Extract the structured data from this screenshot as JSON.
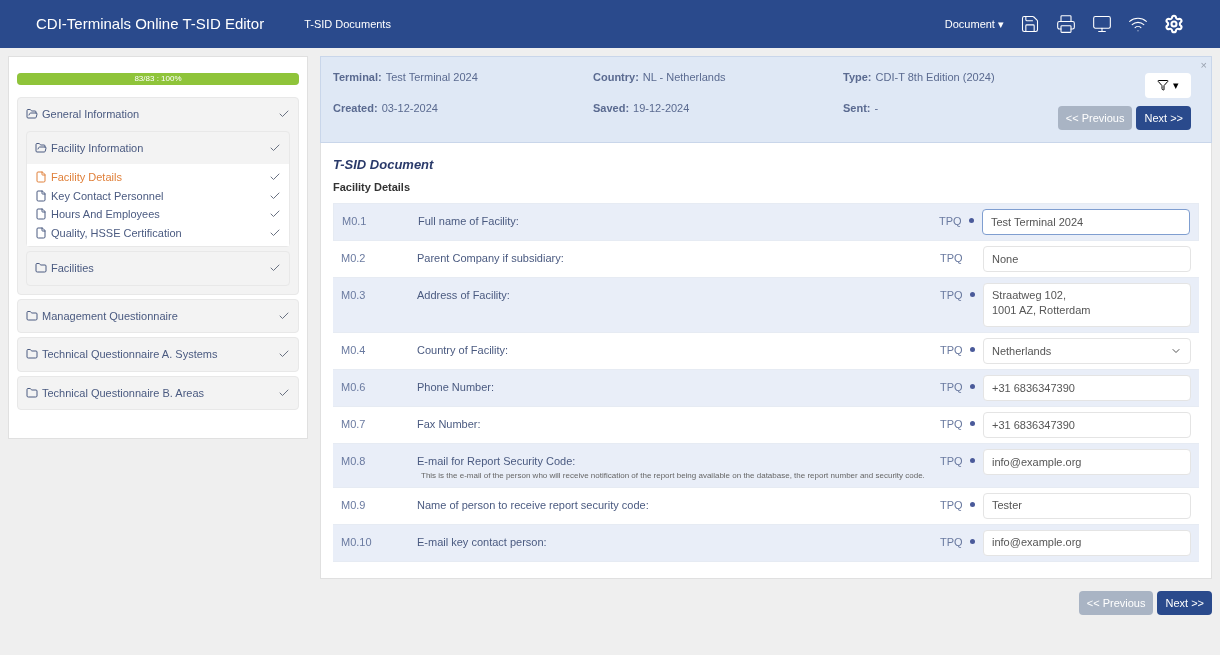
{
  "app": {
    "title": "CDI-Terminals Online T-SID Editor",
    "nav": "T-SID Documents",
    "menu": "Document",
    "menu_caret": "▾"
  },
  "progress": {
    "label": "83/83 : 100%",
    "level": 1
  },
  "tree": [
    {
      "label": "General Information",
      "expanded": true,
      "done": true,
      "selected": false,
      "children": [
        {
          "label": "Facility Information",
          "expanded": true,
          "done": true,
          "selected": false,
          "children": [
            {
              "label": "Facility Details",
              "done": true,
              "selected": true
            },
            {
              "label": "Key Contact Personnel",
              "done": true,
              "selected": false
            },
            {
              "label": "Hours And Employees",
              "done": true,
              "selected": false
            },
            {
              "label": "Quality, HSSE Certification",
              "done": true,
              "selected": false
            }
          ]
        },
        {
          "label": "Facilities",
          "expanded": false,
          "done": true,
          "selected": false
        }
      ]
    },
    {
      "label": "Management Questionnaire",
      "expanded": false,
      "done": true,
      "selected": false
    },
    {
      "label": "Technical Questionnaire A. Systems",
      "expanded": false,
      "done": true,
      "selected": false
    },
    {
      "label": "Technical Questionnaire B. Areas",
      "expanded": false,
      "done": true,
      "selected": false
    }
  ],
  "info": [
    {
      "label": "Terminal:",
      "value": "Test Terminal 2024"
    },
    {
      "label": "Country:",
      "value": "NL - Netherlands"
    },
    {
      "label": "Type:",
      "value": "CDI-T 8th Edition (2024)"
    },
    {
      "label": "Created:",
      "value": "03-12-2024"
    },
    {
      "label": "Saved:",
      "value": "19-12-2024"
    },
    {
      "label": "Sent:",
      "value": "-"
    }
  ],
  "filter_caret": "▾",
  "close": "×",
  "top_pager": {
    "previous": "<< Previous",
    "next": ">>",
    "next_label": "Next",
    "previous_disabled": true
  },
  "document": {
    "title": "T-SID Document",
    "section": "Facility Details"
  },
  "rows": [
    {
      "code": "M0.1",
      "label": "Full name of Facility:",
      "tpq": "TPQ",
      "required": true,
      "kind": "text",
      "value": "Test Terminal 2024",
      "focused": true
    },
    {
      "code": "M0.2",
      "label": "Parent Company if subsidiary:",
      "tpq": "TPQ",
      "required": false,
      "kind": "text",
      "value": "None",
      "focused": false
    },
    {
      "code": "M0.3",
      "label": "Address of Facility:",
      "tpq": "TPQ",
      "required": true,
      "kind": "textarea",
      "value": "Straatweg 102,\n1001 AZ, Rotterdam",
      "focused": false
    },
    {
      "code": "M0.4",
      "label": "Country of Facility:",
      "tpq": "TPQ",
      "required": true,
      "kind": "select",
      "value": "Netherlands",
      "focused": false
    },
    {
      "code": "M0.6",
      "label": "Phone Number:",
      "tpq": "TPQ",
      "required": true,
      "kind": "text",
      "value": "+31 6836347390",
      "focused": false
    },
    {
      "code": "M0.7",
      "label": "Fax Number:",
      "tpq": "TPQ",
      "required": true,
      "kind": "text",
      "value": "+31 6836347390",
      "focused": false
    },
    {
      "code": "M0.8",
      "label": "E-mail for Report Security Code:",
      "note": "This is the e-mail of the person who will receive notification of the report being available on the database, the report number and security code.",
      "tpq": "TPQ",
      "required": true,
      "kind": "text",
      "value": "info@example.org",
      "focused": false
    },
    {
      "code": "M0.9",
      "label": "Name of person to receive report security code:",
      "tpq": "TPQ",
      "required": true,
      "kind": "text",
      "value": "Tester",
      "focused": false
    },
    {
      "code": "M0.10",
      "label": "E-mail key contact person:",
      "tpq": "TPQ",
      "required": true,
      "kind": "text",
      "value": "info@example.org",
      "focused": false
    }
  ],
  "bottom_pager": {
    "previous": "<< Previous",
    "next": ">>",
    "next_label": "Next",
    "previous_disabled": true
  }
}
